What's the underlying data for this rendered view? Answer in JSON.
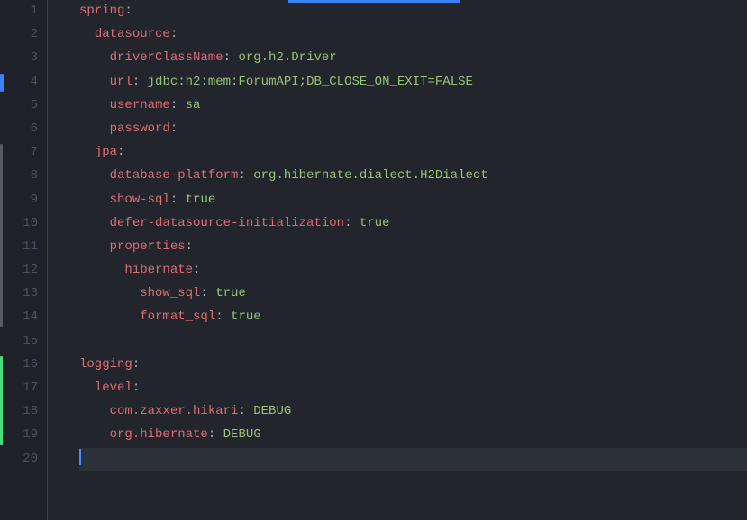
{
  "lineCount": 20,
  "marks": [
    {
      "line": 4,
      "height": 1,
      "color": "#3b82f6",
      "width": 4
    },
    {
      "line": 7,
      "height": 8,
      "color": "#555a63",
      "width": 3
    },
    {
      "line": 16,
      "height": 4,
      "color": "#4ade80",
      "width": 3
    }
  ],
  "code": [
    {
      "indent": 0,
      "tokens": [
        {
          "t": "spring",
          "c": "k"
        },
        {
          "t": ":",
          "c": "p"
        }
      ]
    },
    {
      "indent": 1,
      "tokens": [
        {
          "t": "datasource",
          "c": "k"
        },
        {
          "t": ":",
          "c": "p"
        }
      ]
    },
    {
      "indent": 2,
      "tokens": [
        {
          "t": "driverClassName",
          "c": "k"
        },
        {
          "t": ": ",
          "c": "p"
        },
        {
          "t": "org.h2.Driver",
          "c": "s"
        }
      ]
    },
    {
      "indent": 2,
      "tokens": [
        {
          "t": "url",
          "c": "k"
        },
        {
          "t": ": ",
          "c": "p"
        },
        {
          "t": "jdbc:h2:mem:ForumAPI;DB_CLOSE_ON_EXIT=FALSE",
          "c": "s"
        }
      ]
    },
    {
      "indent": 2,
      "tokens": [
        {
          "t": "username",
          "c": "k"
        },
        {
          "t": ": ",
          "c": "p"
        },
        {
          "t": "sa",
          "c": "s"
        }
      ]
    },
    {
      "indent": 2,
      "tokens": [
        {
          "t": "password",
          "c": "k"
        },
        {
          "t": ":",
          "c": "p"
        }
      ]
    },
    {
      "indent": 1,
      "tokens": [
        {
          "t": "jpa",
          "c": "k"
        },
        {
          "t": ":",
          "c": "p"
        }
      ]
    },
    {
      "indent": 2,
      "tokens": [
        {
          "t": "database-platform",
          "c": "k"
        },
        {
          "t": ": ",
          "c": "p"
        },
        {
          "t": "org.hibernate.dialect.H2Dialect",
          "c": "s"
        }
      ]
    },
    {
      "indent": 2,
      "tokens": [
        {
          "t": "show-sql",
          "c": "k"
        },
        {
          "t": ": ",
          "c": "p"
        },
        {
          "t": "true",
          "c": "s"
        }
      ]
    },
    {
      "indent": 2,
      "tokens": [
        {
          "t": "defer-datasource-initialization",
          "c": "k"
        },
        {
          "t": ": ",
          "c": "p"
        },
        {
          "t": "true",
          "c": "s"
        }
      ]
    },
    {
      "indent": 2,
      "tokens": [
        {
          "t": "properties",
          "c": "k"
        },
        {
          "t": ":",
          "c": "p"
        }
      ]
    },
    {
      "indent": 3,
      "tokens": [
        {
          "t": "hibernate",
          "c": "k"
        },
        {
          "t": ":",
          "c": "p"
        }
      ]
    },
    {
      "indent": 4,
      "tokens": [
        {
          "t": "show_sql",
          "c": "k"
        },
        {
          "t": ": ",
          "c": "p"
        },
        {
          "t": "true",
          "c": "s"
        }
      ]
    },
    {
      "indent": 4,
      "tokens": [
        {
          "t": "format_sql",
          "c": "k"
        },
        {
          "t": ": ",
          "c": "p"
        },
        {
          "t": "true",
          "c": "s"
        }
      ]
    },
    {
      "indent": 0,
      "tokens": []
    },
    {
      "indent": 0,
      "tokens": [
        {
          "t": "logging",
          "c": "k"
        },
        {
          "t": ":",
          "c": "p"
        }
      ]
    },
    {
      "indent": 1,
      "tokens": [
        {
          "t": "level",
          "c": "k"
        },
        {
          "t": ":",
          "c": "p"
        }
      ]
    },
    {
      "indent": 2,
      "tokens": [
        {
          "t": "com.zaxxer.hikari",
          "c": "k"
        },
        {
          "t": ": ",
          "c": "p"
        },
        {
          "t": "DEBUG",
          "c": "s"
        }
      ]
    },
    {
      "indent": 2,
      "tokens": [
        {
          "t": "org.hibernate",
          "c": "k"
        },
        {
          "t": ": ",
          "c": "p"
        },
        {
          "t": "DEBUG",
          "c": "s"
        }
      ]
    },
    {
      "indent": 0,
      "tokens": [],
      "current": true
    }
  ]
}
